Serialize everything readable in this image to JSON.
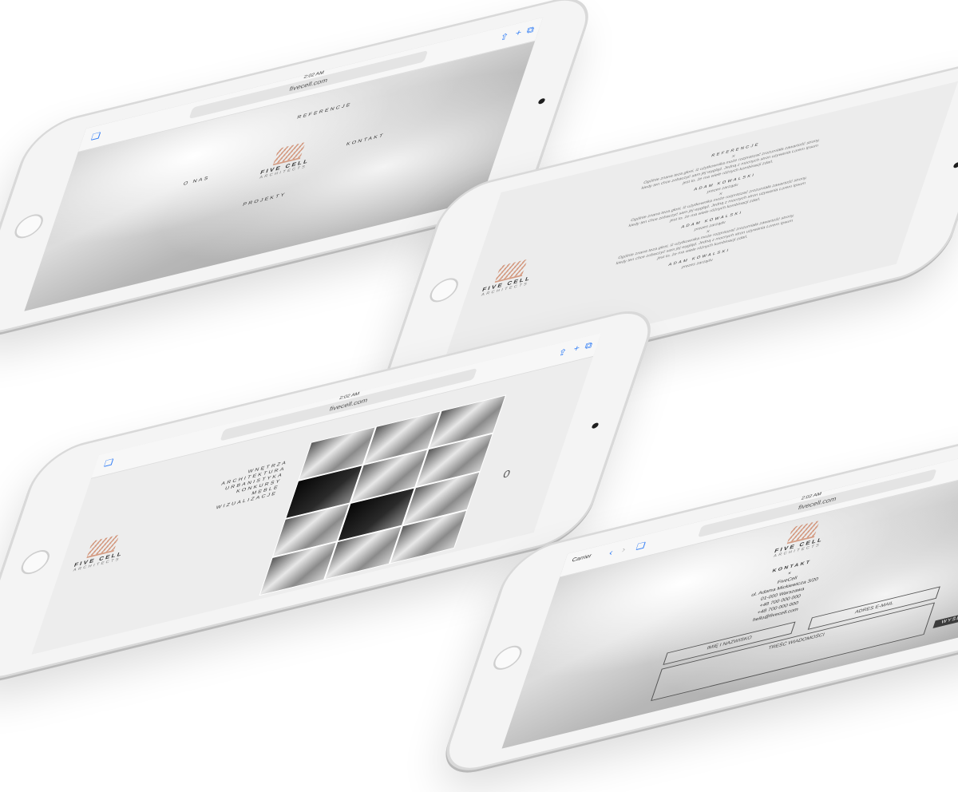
{
  "tablet_home": {
    "time": "2:02 AM",
    "url": "fivecell.com",
    "brand": "FIVE CELL",
    "brand_sub": "ARCHITECTS",
    "menu": [
      "O NAS",
      "PROJEKTY",
      "REFERENCJE",
      "KONTAKT"
    ]
  },
  "tablet_references": {
    "heading": "REFERENCJE",
    "brand": "FIVE CELL",
    "brand_sub": "ARCHITECTS",
    "quote": "Ogólnie znana teza głosi, iż użytkownika może rozpraszać zrozumiała zawartość strony, kiedy ten chce zobaczyć sam jej wygląd. Jedną z mocnych stron używania Lorem Ipsum jest to, że ma wiele różnych kombinacji zdań.",
    "entries": [
      {
        "name": "ADAM KOWALSKI",
        "role": "prezes zarządu"
      },
      {
        "name": "ADAM KOWALSKI",
        "role": "prezes zarządu"
      },
      {
        "name": "ADAM KOWALSKI",
        "role": "prezes zarządu"
      },
      {
        "name": "ADAM KOWALSKI",
        "role": "prezes zarządu"
      }
    ]
  },
  "tablet_projects": {
    "time": "2:02 AM",
    "url": "fivecell.com",
    "brand": "FIVE CELL",
    "brand_sub": "ARCHITECTS",
    "filters": [
      "WNĘTRZA",
      "ARCHITEKTURA",
      "URBANISTYKA",
      "KONKURSY",
      "MEBLE",
      "WIZUALIZACJE"
    ],
    "page_number": "0"
  },
  "tablet_contact": {
    "time": "2:02 AM",
    "url": "fivecell.com",
    "brand": "FIVE CELL",
    "brand_sub": "ARCHITECTS",
    "heading": "KONTAKT",
    "company": "FiveCell",
    "address": "ul. Adama Mickiewicza 3/20",
    "city": "01-000 Warszawa",
    "phone1": "+48 700 000 000",
    "phone2": "+48 700 000 000",
    "email": "hello@fivecell.com",
    "name_placeholder": "IMIĘ I NAZWISKO",
    "email_placeholder": "ADRES E-MAIL",
    "message_placeholder": "TREŚĆ WIADOMOŚCI",
    "send_label": "WYŚLIJ",
    "carrier": "Carrier"
  }
}
